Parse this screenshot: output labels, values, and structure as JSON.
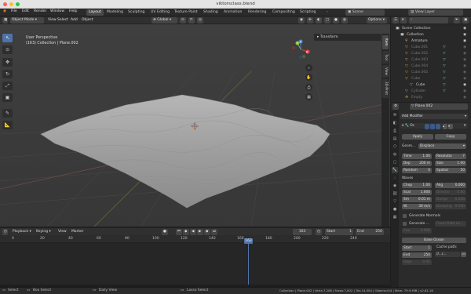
{
  "window": {
    "title": "viktorsclass.blend"
  },
  "menu": {
    "items": [
      "File",
      "Edit",
      "Render",
      "Window",
      "Help"
    ],
    "workspaces": [
      "Layout",
      "Modeling",
      "Sculpting",
      "UV Editing",
      "Texture Paint",
      "Shading",
      "Animation",
      "Rendering",
      "Compositing",
      "Scripting"
    ],
    "active_workspace": "Layout",
    "scene": "Scene",
    "view_layer": "View Layer"
  },
  "viewport_header": {
    "mode": "Object Mode",
    "menus": [
      "View",
      "Select",
      "Add",
      "Object"
    ],
    "orientation": "Global",
    "options": "Options"
  },
  "viewport": {
    "perspective": "User Perspective",
    "info": "(163) Collection | Plane.002",
    "npanel_tab": "Transform",
    "sidebar_tabs": [
      "Item",
      "Tool",
      "View",
      "3D-Print"
    ],
    "gizmo_axes": [
      "X",
      "Y",
      "Z"
    ]
  },
  "timeline": {
    "menus": [
      "Playback",
      "Keying",
      "View",
      "Marker"
    ],
    "current_frame": "163",
    "start_label": "Start",
    "start_value": "1",
    "end_label": "End",
    "end_value": "250",
    "ticks": [
      "0",
      "20",
      "40",
      "60",
      "80",
      "100",
      "120",
      "140",
      "160",
      "180",
      "200",
      "220",
      "240"
    ],
    "playhead": "163"
  },
  "statusbar": {
    "left": [
      "Select",
      "Box Select",
      "Daily View",
      "Lasso Select"
    ],
    "right": "Collection | Plane.002 | Verts:7,208 | Faces:7,002 | Tris:14,004 | Objects:0/4 | Mem: 79.9 MiB | v2.81.16"
  },
  "outliner": {
    "rows": [
      {
        "label": "Scene Collection",
        "indent": 0,
        "dim": false,
        "selected": false,
        "icon": "collection-icon"
      },
      {
        "label": "Collection",
        "indent": 1,
        "dim": false,
        "selected": false,
        "icon": "collection-icon"
      },
      {
        "label": "Armature",
        "indent": 2,
        "dim": false,
        "selected": false,
        "icon": "armature-icon"
      },
      {
        "label": "Cube.001",
        "indent": 2,
        "dim": true,
        "selected": false,
        "icon": "mesh-icon"
      },
      {
        "label": "Cube.002",
        "indent": 2,
        "dim": true,
        "selected": false,
        "icon": "mesh-icon"
      },
      {
        "label": "Cube.003",
        "indent": 2,
        "dim": true,
        "selected": false,
        "icon": "mesh-icon"
      },
      {
        "label": "Cube.004",
        "indent": 2,
        "dim": true,
        "selected": false,
        "icon": "mesh-icon"
      },
      {
        "label": "Cube.005",
        "indent": 2,
        "dim": true,
        "selected": false,
        "icon": "mesh-icon"
      },
      {
        "label": "Cube",
        "indent": 2,
        "dim": true,
        "selected": false,
        "icon": "mesh-icon"
      },
      {
        "label": "Cube",
        "indent": 3,
        "dim": false,
        "selected": false,
        "icon": "mesh-icon"
      },
      {
        "label": "Cylinder",
        "indent": 2,
        "dim": true,
        "selected": false,
        "icon": "mesh-icon"
      },
      {
        "label": "Empty",
        "indent": 2,
        "dim": true,
        "selected": false,
        "icon": "empty-icon"
      }
    ]
  },
  "properties": {
    "object_name": "Plane.002",
    "add_modifier": "Add Modifier",
    "modifier_name": "Oc",
    "apply": "Apply",
    "copy": "Copy",
    "geometry_label": "Geom...",
    "displace": "Displace",
    "fields_left": [
      {
        "label": "Time",
        "value": "1.00"
      },
      {
        "label": "Dep",
        "value": "200 m"
      },
      {
        "label": "Random",
        "value": "0"
      }
    ],
    "fields_right": [
      {
        "label": "Resolutio",
        "value": "7"
      },
      {
        "label": "Size",
        "value": "1.00"
      },
      {
        "label": "Spatial",
        "value": "50"
      }
    ],
    "waves_label": "Waves",
    "waves_left": [
      {
        "label": "Chop",
        "value": "1.00"
      },
      {
        "label": "Scal",
        "value": "1.000"
      },
      {
        "label": "Sm",
        "value": "0.01 m"
      },
      {
        "label": "W.",
        "value": "30 m/s"
      }
    ],
    "waves_right": [
      {
        "label": "Alig",
        "value": "0.000",
        "disabled": false
      },
      {
        "label": "Directio",
        "value": "0.00",
        "disabled": true
      },
      {
        "label": "Dampi",
        "value": "0.500",
        "disabled": true
      },
      {
        "label": "Damping",
        "value": "0.500",
        "disabled": true
      }
    ],
    "generate_normals": "Generate Normals",
    "generate_foam": "Generate ...",
    "foam_data": "Foam Data La...",
    "cov": "Cov",
    "cov_value": "0.000",
    "bake_ocean": "Bake Ocean",
    "start_label": "Start",
    "start_value": "1",
    "end_label": "End",
    "end_value": "250",
    "cache_label": "Cache path:",
    "cache_value": "//.../...",
    "repeat_label": "Repe",
    "repeat_value": "0.00"
  }
}
